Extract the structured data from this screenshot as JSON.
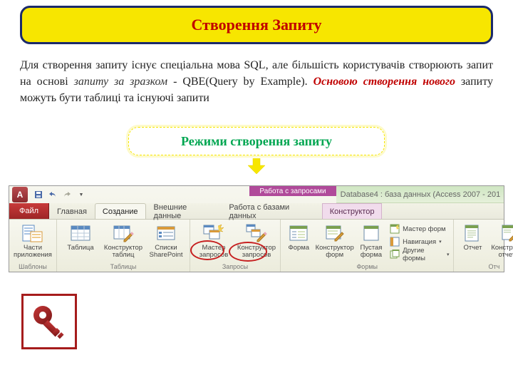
{
  "title": "Створення Запиту",
  "paragraph": {
    "t1": "Для створення запиту існує спеціальна мова SQL, але більшість користувачів створюють запит на основі ",
    "t2": "запиту за зразком",
    "t3": " -  QBE(Query by Example). ",
    "t4": "Основою створення нового",
    "t5": " запиту можуть бути таблиці  та існуючі запити"
  },
  "subtitle": "Режими створення запиту",
  "ribbon": {
    "app_letter": "A",
    "context_title": "Работа с запросами",
    "db_title": "Database4 : база данных (Access 2007 - 201",
    "tabs": {
      "file": "Файл",
      "home": "Главная",
      "create": "Создание",
      "external": "Внешние данные",
      "dbtools": "Работа с базами данных",
      "design": "Конструктор"
    },
    "groups": {
      "templates": {
        "label": "Шаблоны",
        "parts": "Части\nприложения"
      },
      "tables": {
        "label": "Таблицы",
        "table": "Таблица",
        "design": "Конструктор\nтаблиц",
        "sharepoint": "Списки\nSharePoint"
      },
      "queries": {
        "label": "Запросы",
        "wizard": "Мастер\nзапросов",
        "design": "Конструктор\nзапросов"
      },
      "forms": {
        "label": "Формы",
        "form": "Форма",
        "fdesign": "Конструктор\nформ",
        "blank": "Пустая\nформа",
        "wizard": "Мастер форм",
        "nav": "Навигация",
        "other": "Другие формы"
      },
      "reports": {
        "label": "Отч",
        "report": "Отчет",
        "rdesign": "Конструктор\nотчетов"
      }
    }
  },
  "colors": {
    "accent_red": "#c00000",
    "accent_yellow": "#f7e600",
    "accent_green": "#00a651",
    "border_blue": "#1b2a6b"
  }
}
